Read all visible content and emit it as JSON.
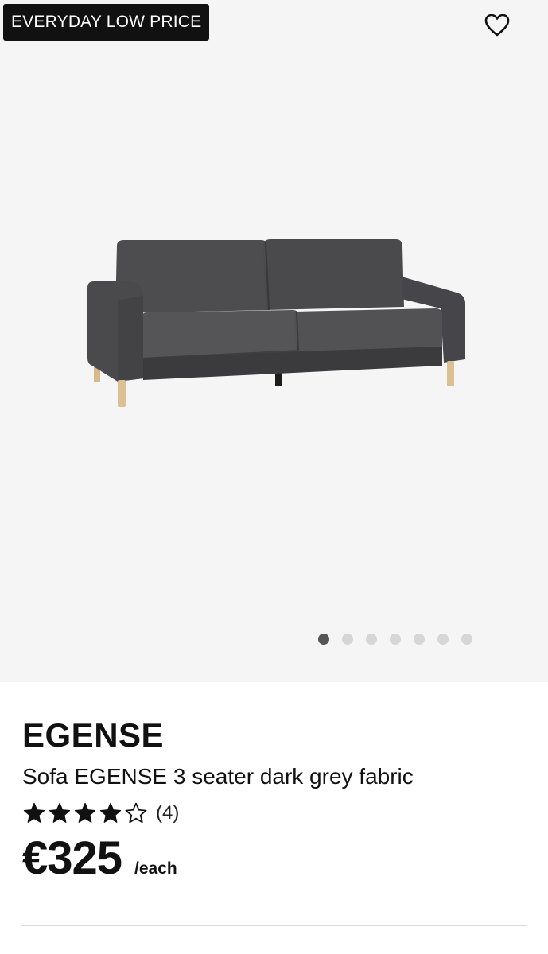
{
  "badge": {
    "label": "EVERYDAY LOW PRICE"
  },
  "favorite": {
    "icon": "heart-icon"
  },
  "gallery": {
    "image_count": 7,
    "active_index": 0
  },
  "product": {
    "brand": "EGENSE",
    "description": "Sofa EGENSE 3 seater dark grey fabric",
    "rating": {
      "stars": 4,
      "max": 5,
      "count_label": "(4)"
    },
    "price": "€325",
    "unit": "/each"
  },
  "colors": {
    "badge_bg": "#111111",
    "gallery_bg": "#f5f5f5",
    "dot_active": "#555555",
    "dot_inactive": "#d6d6d6"
  }
}
